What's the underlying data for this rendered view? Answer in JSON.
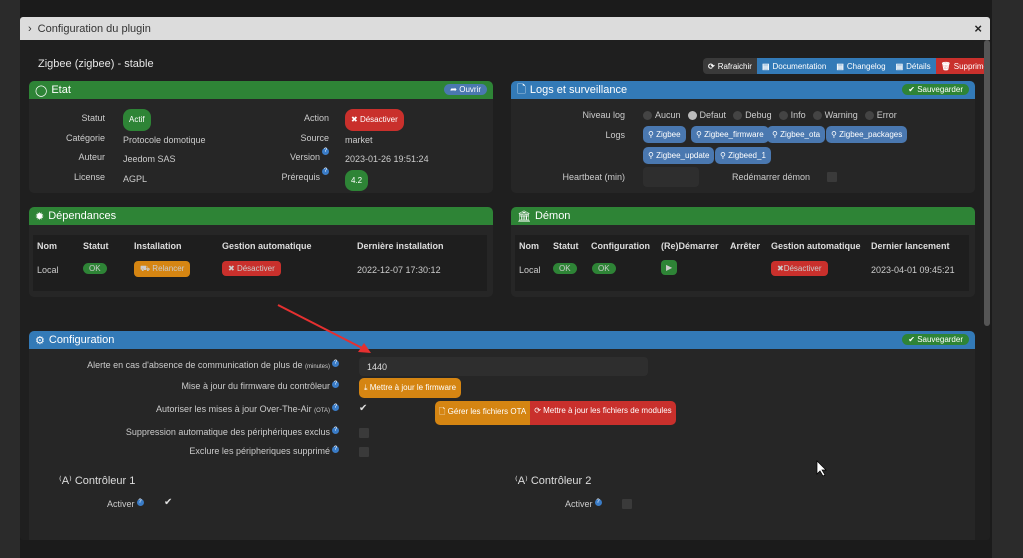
{
  "modal": {
    "title": "Configuration du plugin",
    "close": "×"
  },
  "plugin_title": "Zigbee (zigbee) - stable",
  "toolbar": {
    "refresh": "Rafraichir",
    "documentation": "Documentation",
    "changelog": "Changelog",
    "details": "Détails",
    "delete": "Supprimer"
  },
  "etat": {
    "title": "Etat",
    "open": "Ouvrir",
    "statut_label": "Statut",
    "statut": "Actif",
    "categorie_label": "Catégorie",
    "categorie": "Protocole domotique",
    "auteur_label": "Auteur",
    "auteur": "Jeedom SAS",
    "license_label": "License",
    "license": "AGPL",
    "action_label": "Action",
    "action": "Désactiver",
    "source_label": "Source",
    "source": "market",
    "version_label": "Version",
    "version": "2023-01-26 19:51:24",
    "prerequis_label": "Prérequis",
    "prerequis": "4.2"
  },
  "logs": {
    "title": "Logs et surveillance",
    "save": "Sauvegarder",
    "niveau_label": "Niveau log",
    "levels": [
      "Aucun",
      "Defaut",
      "Debug",
      "Info",
      "Warning",
      "Error"
    ],
    "selected": "Defaut",
    "logs_label": "Logs",
    "files": [
      "Zigbee",
      "Zigbee_firmware",
      "Zigbee_ota",
      "Zigbee_packages",
      "Zigbee_update",
      "Zigbeed_1"
    ],
    "heartbeat_label": "Heartbeat (min)",
    "heartbeat": "",
    "restart_label": "Redémarrer démon",
    "restart_checked": false
  },
  "dependances": {
    "title": "Dépendances",
    "headers": [
      "Nom",
      "Statut",
      "Installation",
      "Gestion automatique",
      "Dernière installation"
    ],
    "row": {
      "nom": "Local",
      "statut": "OK",
      "installation": "Relancer",
      "gestion": "Désactiver",
      "derniere": "2022-12-07 17:30:12"
    }
  },
  "demon": {
    "title": "Démon",
    "headers": [
      "Nom",
      "Statut",
      "Configuration",
      "(Re)Démarrer",
      "Arrêter",
      "Gestion automatique",
      "Dernier lancement"
    ],
    "row": {
      "nom": "Local",
      "statut": "OK",
      "configuration": "OK",
      "gestion": "Désactiver",
      "dernier": "2023-04-01 09:45:21"
    }
  },
  "configuration": {
    "title": "Configuration",
    "save": "Sauvegarder",
    "alerte_label": "Alerte en cas d'absence de communication de plus de",
    "alerte_unit": "(minutes)",
    "alerte": "1440",
    "firmware_label": "Mise à jour du firmware du contrôleur",
    "firmware_btn": "Mettre à jour le firmware",
    "ota_label": "Autoriser les mises à jour Over-The-Air",
    "ota_unit": "(OTA)",
    "ota_checked": true,
    "ota_files_btn": "Gérer les fichiers OTA",
    "modules_btn": "Mettre à jour les fichiers de modules",
    "suppression_label": "Suppression automatique des périphériques exclus",
    "suppression_checked": false,
    "exclure_label": "Exclure les péripheriques supprimé",
    "exclure_checked": false,
    "controleur1": {
      "title": "Contrôleur 1",
      "activer_label": "Activer",
      "activer_checked": true
    },
    "controleur2": {
      "title": "Contrôleur 2",
      "activer_label": "Activer",
      "activer_checked": false
    }
  },
  "colors": {
    "green": "#2e8436",
    "blue": "#337ab7",
    "red": "#c9302c",
    "orange": "#d58512"
  }
}
